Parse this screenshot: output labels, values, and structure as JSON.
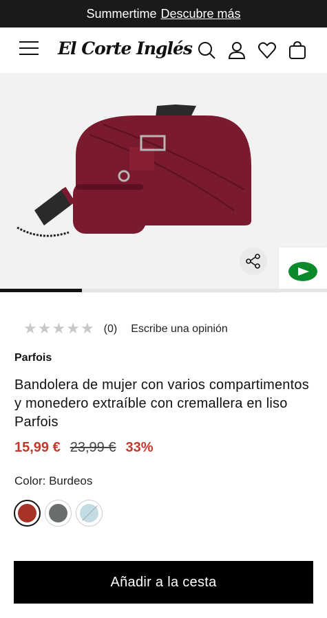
{
  "promo": {
    "text": "Summertime",
    "link": "Descubre más"
  },
  "header": {
    "logo": "El Corte Inglés",
    "icons": [
      "menu-icon",
      "search-icon",
      "user-icon",
      "heart-icon",
      "bag-icon"
    ]
  },
  "gallery": {
    "progress": 0.25
  },
  "rating": {
    "stars": 5,
    "filled": 0,
    "count": "(0)",
    "write_review": "Escribe una opinión"
  },
  "product": {
    "brand": "Parfois",
    "title": "Bandolera de mujer con varios compartimentos y monedero extraíble con cremallera en liso Parfois",
    "price_current": "15,99 €",
    "price_old": "23,99 €",
    "discount": "33%",
    "color_label": "Color: Burdeos",
    "colors": [
      {
        "hex": "#a83226",
        "selected": true,
        "available": true
      },
      {
        "hex": "#6a6d6d",
        "selected": false,
        "available": true
      },
      {
        "hex": "#c4dde5",
        "selected": false,
        "available": false
      }
    ]
  },
  "actions": {
    "add_to_cart": "Añadir a la cesta"
  },
  "colors": {
    "accent_price": "#c0392b",
    "bag": "#7a1a2e",
    "chat_green": "#0b8a2c"
  }
}
